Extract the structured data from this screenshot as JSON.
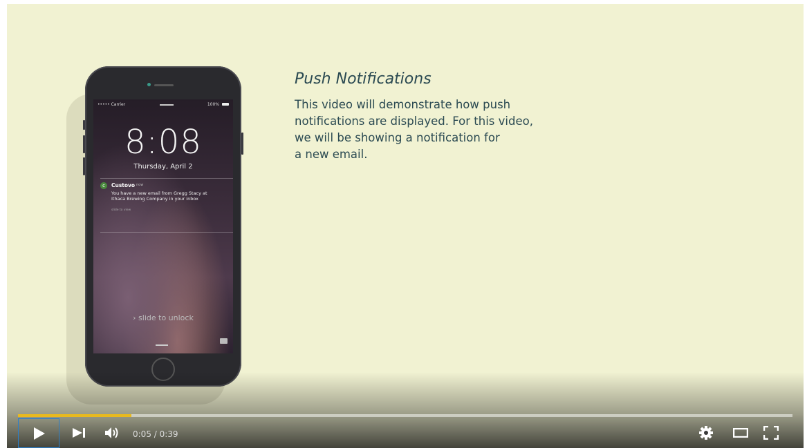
{
  "slide": {
    "title": "Push Notifications",
    "body": "This video will demonstrate how push\nnotifications are displayed. For this video,\nwe will be showing a notification for\na new email."
  },
  "phone": {
    "carrier": "••••• Carrier",
    "battery": "100%",
    "time": "8:08",
    "date": "Thursday, April 2",
    "notification": {
      "app": "Custovo",
      "when": "now",
      "body": "You have a new email from Gregg Stacy at Ithaca Brewing Company in your inbox",
      "hint": "slide to view"
    },
    "unlock": "› slide to unlock"
  },
  "player": {
    "current_time": "0:05 / 0:39",
    "progress_fraction": 0.146,
    "accent": "#e8b91f",
    "icons": [
      "play-icon",
      "next-icon",
      "volume-icon",
      "settings-icon",
      "theater-mode-icon",
      "fullscreen-icon"
    ]
  }
}
